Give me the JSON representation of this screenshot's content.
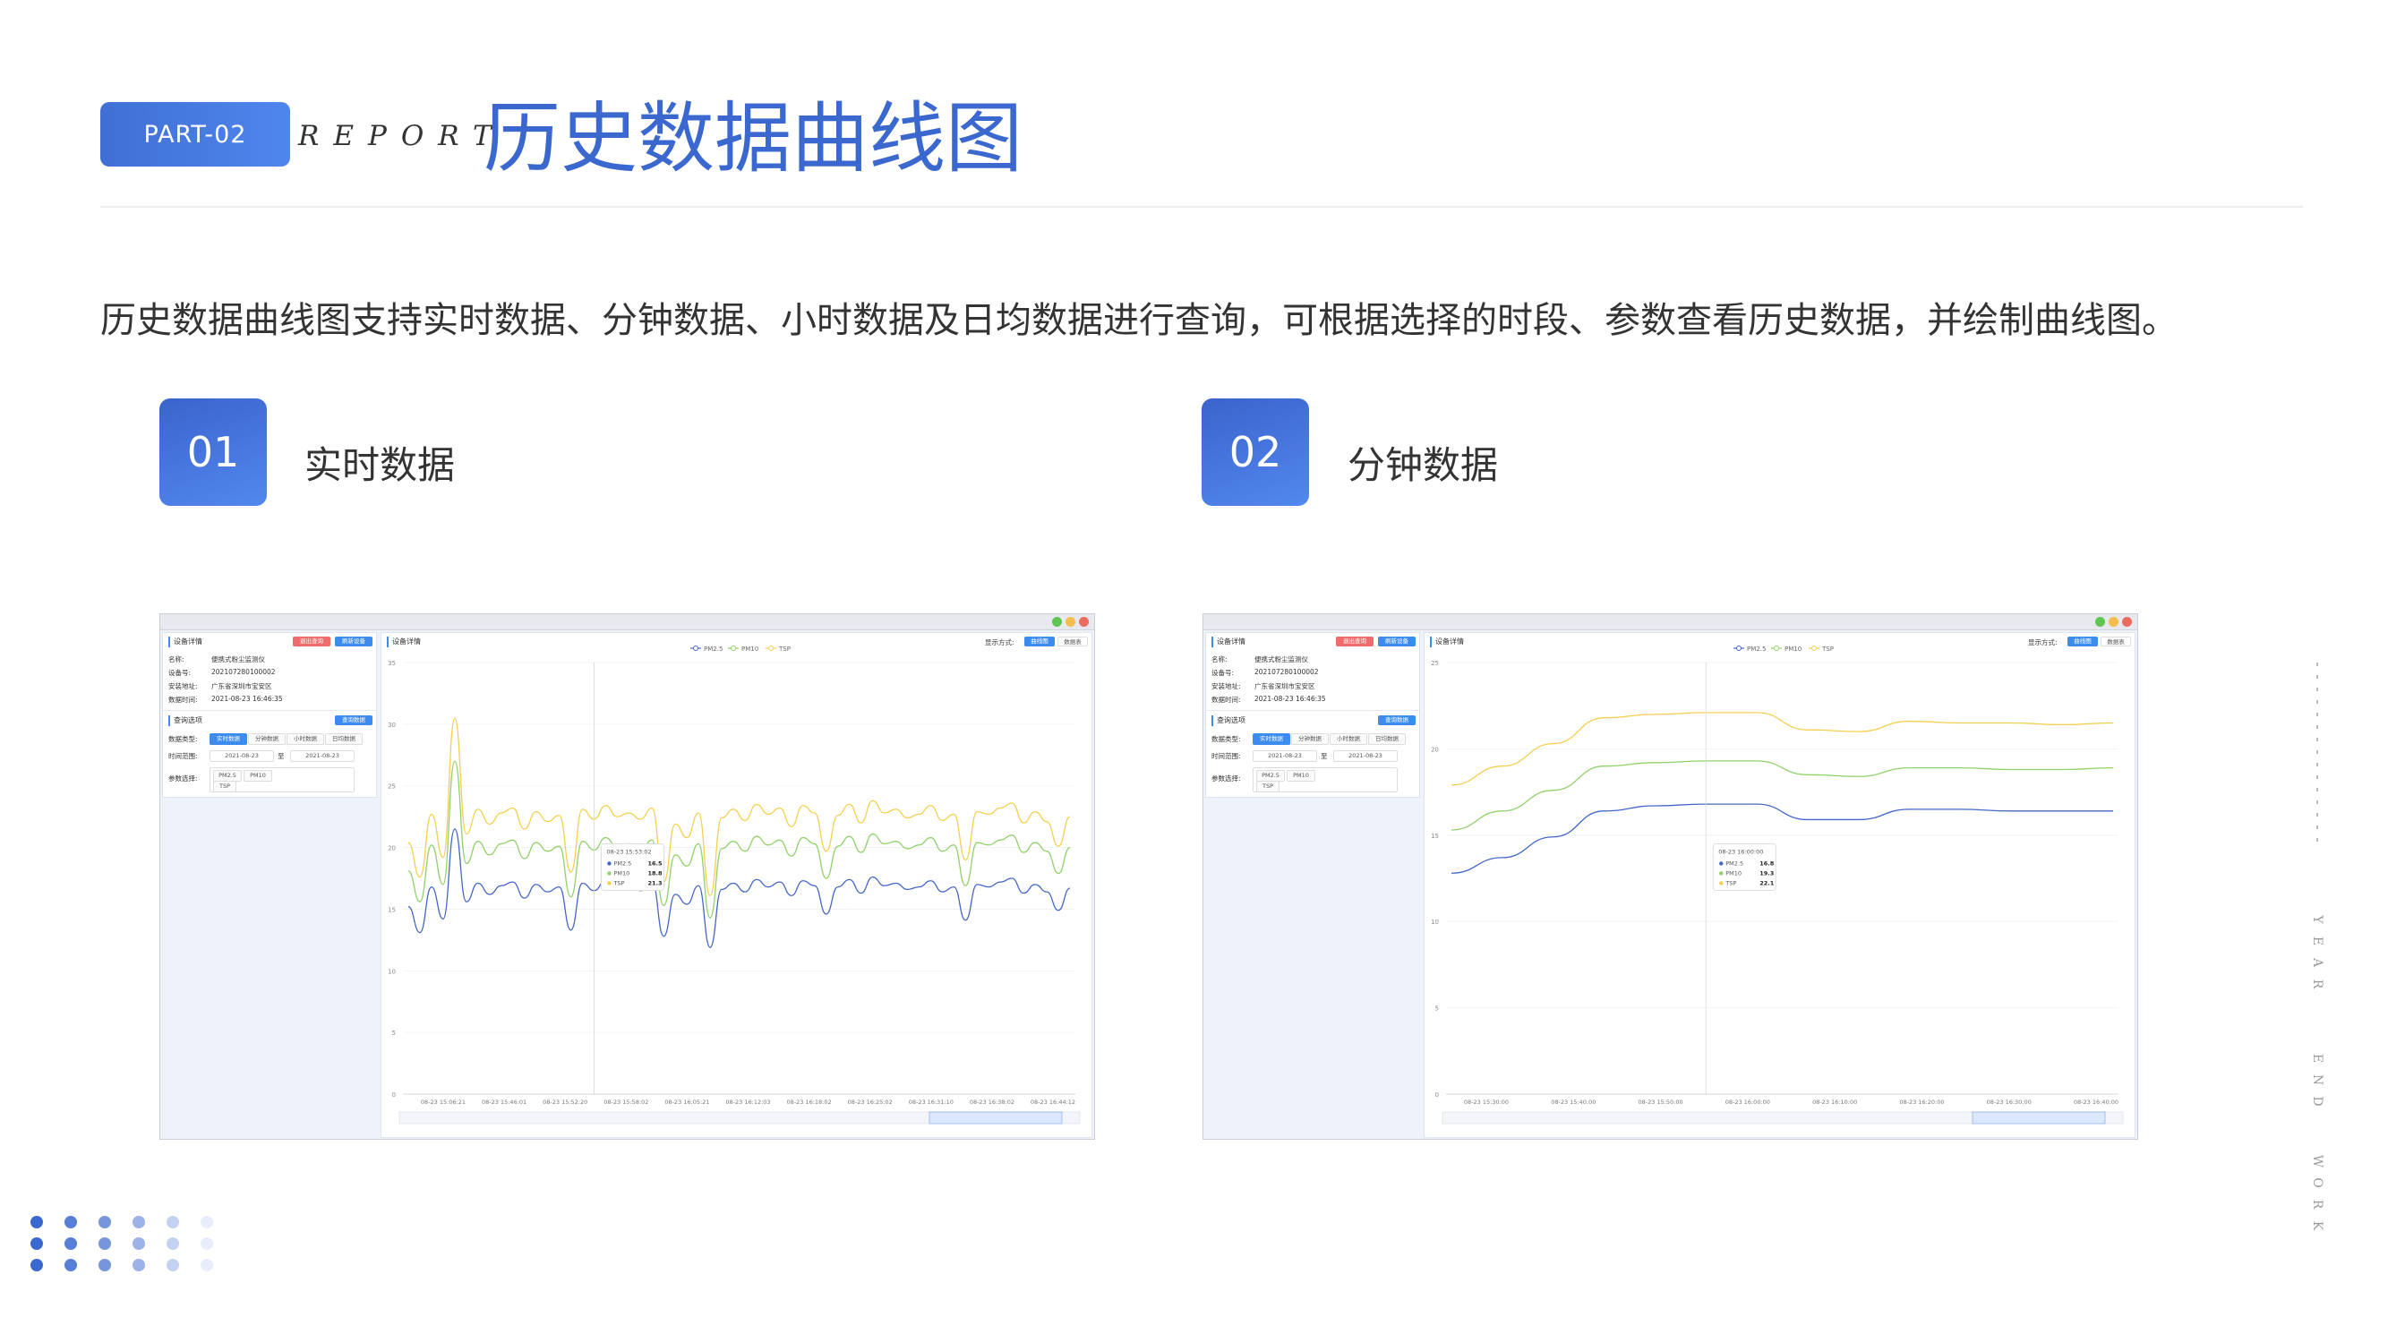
{
  "header": {
    "part_label": "PART-02",
    "report_label": "REPORT",
    "title": "历史数据曲线图"
  },
  "description": "历史数据曲线图支持实时数据、分钟数据、小时数据及日均数据进行查询，可根据选择的时段、参数查看历史数据，并绘制曲线图。",
  "sections": [
    {
      "number": "01",
      "title": "实时数据"
    },
    {
      "number": "02",
      "title": "分钟数据"
    }
  ],
  "side_text": {
    "year": "YEAR",
    "end": "END",
    "work": "WORK"
  },
  "colors": {
    "accent": "#3b68cf",
    "pm25": "#4466c8",
    "pm10": "#8fd16a",
    "tsp": "#f5cf4f",
    "btn_red": "#f06b6b",
    "btn_blue": "#3c8cf0"
  },
  "app": {
    "device_panel_title": "设备详情",
    "btn_return": "退出查询",
    "btn_refresh": "刷新设备",
    "fields": [
      {
        "label": "名称:",
        "value": "便携式粉尘监测仪"
      },
      {
        "label": "设备号:",
        "value": "202107280100002"
      },
      {
        "label": "安装地址:",
        "value": "广东省深圳市宝安区"
      },
      {
        "label": "数据时间:",
        "value": "2021-08-23 16:46:35"
      }
    ],
    "query_panel_title": "查询选项",
    "btn_query": "查询数据",
    "data_type_label": "数据类型:",
    "data_types": [
      "实时数据",
      "分钟数据",
      "小时数据",
      "日均数据"
    ],
    "time_range_label": "时间范围:",
    "date_from": "2021-08-23",
    "date_sep": "至",
    "date_to": "2021-08-23",
    "param_label": "参数选择:",
    "params": [
      "PM2.5",
      "PM10",
      "TSP"
    ],
    "chart_panel_title": "设备详情",
    "display_label": "显示方式:",
    "btn_curve": "曲线图",
    "btn_table": "数据表",
    "legend": [
      "PM2.5",
      "PM10",
      "TSP"
    ]
  },
  "chart_data": [
    {
      "type": "line",
      "title": "",
      "ylim": [
        0,
        35
      ],
      "y_ticks": [
        0,
        5,
        10,
        15,
        20,
        25,
        30,
        35
      ],
      "x_tick_labels": [
        "08-23 15:06:21",
        "08-23 15:46:01",
        "08-23 15:52:20",
        "08-23 15:58:02",
        "08-23 16:05:21",
        "08-23 16:12:03",
        "08-23 16:18:02",
        "08-23 16:25:02",
        "08-23 16:31:10",
        "08-23 16:38:02",
        "08-23 16:44:12"
      ],
      "series": [
        {
          "name": "PM2.5",
          "values": [
            15.2,
            13.1,
            16.8,
            14.2,
            21.5,
            15.6,
            17.1,
            16.2,
            16.9,
            17.2,
            15.9,
            17.0,
            16.4,
            16.8,
            13.3,
            17.1,
            16.5,
            17.3,
            16.7,
            16.9,
            16.5,
            17.2,
            12.8,
            16.2,
            15.4,
            16.9,
            11.9,
            16.6,
            17.1,
            16.4,
            17.4,
            16.8,
            17.2,
            16.1,
            17.3,
            16.9,
            14.6,
            16.8,
            17.4,
            16.3,
            17.6,
            16.9,
            17.1,
            16.6,
            16.8,
            17.3,
            16.4,
            16.8,
            14.1,
            17.0,
            16.8,
            17.2,
            17.5,
            16.3,
            17.0,
            16.4,
            14.9,
            16.7
          ]
        },
        {
          "name": "PM10",
          "values": [
            18.1,
            15.6,
            20.2,
            17.0,
            27.0,
            18.7,
            20.5,
            19.4,
            20.3,
            20.6,
            19.1,
            20.4,
            19.7,
            20.1,
            16.0,
            20.5,
            19.8,
            20.8,
            20.0,
            20.3,
            19.8,
            20.6,
            15.3,
            19.4,
            18.5,
            20.3,
            14.3,
            19.9,
            20.5,
            19.7,
            20.9,
            20.2,
            20.6,
            19.3,
            20.8,
            20.3,
            17.5,
            20.1,
            20.9,
            19.6,
            21.1,
            20.3,
            20.5,
            19.9,
            20.2,
            20.8,
            19.7,
            20.2,
            16.9,
            20.4,
            20.2,
            20.6,
            21.0,
            19.6,
            20.4,
            19.7,
            17.9,
            20.0
          ]
        },
        {
          "name": "TSP",
          "values": [
            20.4,
            17.6,
            22.7,
            19.2,
            30.5,
            21.1,
            23.1,
            21.9,
            22.8,
            23.2,
            21.5,
            22.9,
            22.1,
            22.6,
            18.0,
            23.1,
            22.3,
            23.4,
            22.5,
            22.8,
            22.3,
            23.2,
            17.2,
            21.9,
            20.8,
            22.8,
            16.1,
            22.4,
            23.1,
            22.2,
            23.5,
            22.7,
            23.2,
            21.7,
            23.4,
            22.8,
            19.7,
            22.6,
            23.5,
            22.0,
            23.8,
            22.8,
            23.1,
            22.4,
            22.7,
            23.4,
            22.2,
            22.7,
            19.0,
            22.9,
            22.7,
            23.2,
            23.6,
            22.0,
            22.9,
            22.1,
            20.1,
            22.5
          ]
        }
      ],
      "tooltip": {
        "time": "08-23 15:53:02",
        "rows": [
          {
            "name": "PM2.5",
            "value": "16.5"
          },
          {
            "name": "PM10",
            "value": "18.8"
          },
          {
            "name": "TSP",
            "value": "21.3"
          }
        ]
      }
    },
    {
      "type": "line",
      "title": "",
      "ylim": [
        0,
        25
      ],
      "y_ticks": [
        0,
        5,
        10,
        15,
        20,
        25
      ],
      "x_tick_labels": [
        "08-23 15:30:00",
        "08-23 15:40:00",
        "08-23 15:50:00",
        "08-23 16:00:00",
        "08-23 16:10:00",
        "08-23 16:20:00",
        "08-23 16:30:00",
        "08-23 16:40:00"
      ],
      "series": [
        {
          "name": "PM2.5",
          "values": [
            12.8,
            13.7,
            14.9,
            16.4,
            16.7,
            16.8,
            16.8,
            15.9,
            15.9,
            16.5,
            16.5,
            16.4,
            16.4,
            16.4
          ]
        },
        {
          "name": "PM10",
          "values": [
            15.3,
            16.4,
            17.6,
            19.0,
            19.2,
            19.3,
            19.3,
            18.5,
            18.4,
            18.9,
            18.9,
            18.8,
            18.8,
            18.9
          ]
        },
        {
          "name": "TSP",
          "values": [
            17.9,
            19.0,
            20.3,
            21.8,
            22.0,
            22.1,
            22.1,
            21.1,
            21.0,
            21.6,
            21.5,
            21.5,
            21.4,
            21.5
          ]
        }
      ],
      "tooltip": {
        "time": "08-23 16:00:00",
        "rows": [
          {
            "name": "PM2.5",
            "value": "16.8"
          },
          {
            "name": "PM10",
            "value": "19.3"
          },
          {
            "name": "TSP",
            "value": "22.1"
          }
        ]
      }
    }
  ]
}
